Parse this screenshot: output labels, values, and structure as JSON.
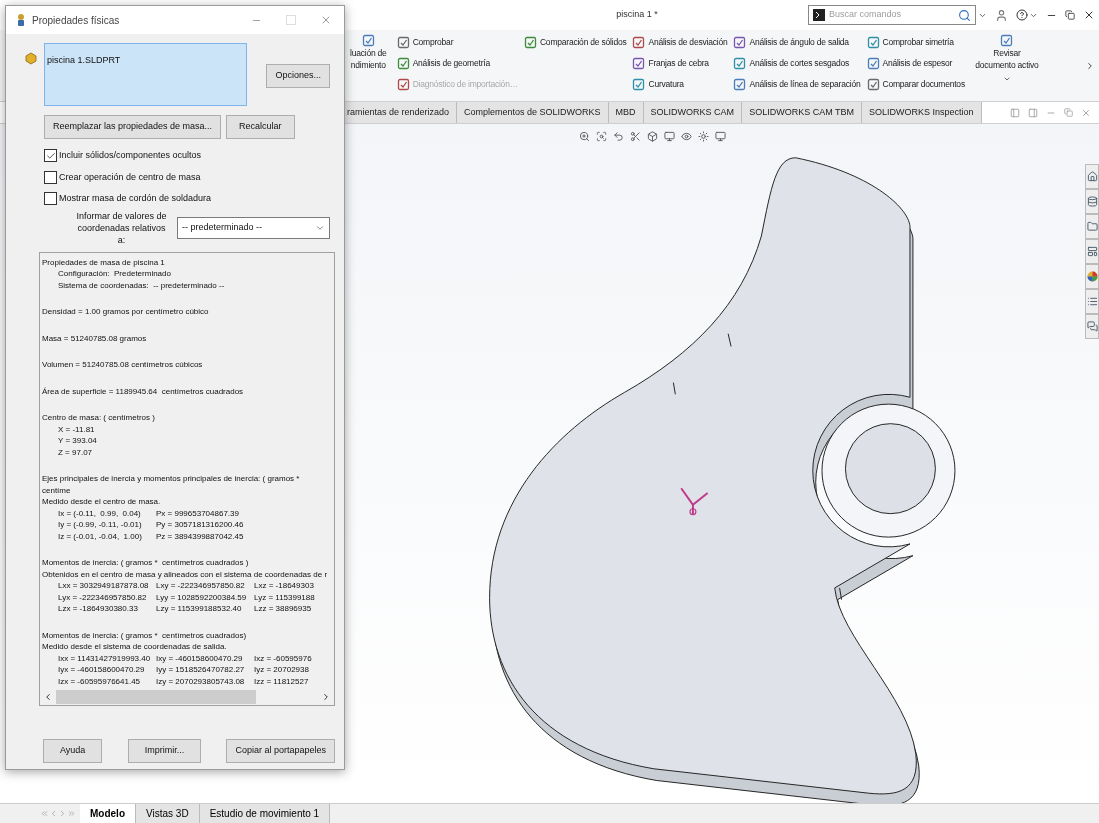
{
  "app": {
    "title": "piscina 1 *",
    "search": {
      "placeholder": "Buscar comandos"
    }
  },
  "ribbon": {
    "groups": [
      {
        "kind": "large",
        "lines": [
          "luación de",
          "ndimiento"
        ]
      },
      {
        "kind": "list",
        "items": [
          {
            "label": "Comprobar",
            "disabled": false
          },
          {
            "label": "Análisis de geometría",
            "disabled": false
          },
          {
            "label": "Diagnóstico de importación…",
            "disabled": true
          }
        ]
      },
      {
        "kind": "list",
        "items": [
          {
            "label": "Comparación de sólidos",
            "disabled": false
          }
        ]
      },
      {
        "kind": "list",
        "items": [
          {
            "label": "Análisis de desviación",
            "disabled": false
          },
          {
            "label": "Franjas de cebra",
            "disabled": false
          },
          {
            "label": "Curvatura",
            "disabled": false
          }
        ]
      },
      {
        "kind": "list",
        "items": [
          {
            "label": "Análisis de ángulo de salida",
            "disabled": false
          },
          {
            "label": "Análisis de cortes sesgados",
            "disabled": false
          },
          {
            "label": "Análisis de línea de separación",
            "disabled": false
          }
        ]
      },
      {
        "kind": "list",
        "items": [
          {
            "label": "Comprobar simetría",
            "disabled": false
          },
          {
            "label": "Análisis de espesor",
            "disabled": false
          },
          {
            "label": "Comparar documentos",
            "disabled": false
          }
        ]
      },
      {
        "kind": "large",
        "lines": [
          "Revisar documento activo"
        ]
      }
    ]
  },
  "command_tabs": [
    {
      "label": "ramientas de renderizado",
      "selected": false
    },
    {
      "label": "Complementos de SOLIDWORKS",
      "selected": false
    },
    {
      "label": "MBD",
      "selected": false
    },
    {
      "label": "SOLIDWORKS CAM",
      "selected": false
    },
    {
      "label": "SOLIDWORKS CAM TBM",
      "selected": false
    },
    {
      "label": "SOLIDWORKS Inspection",
      "selected": false
    }
  ],
  "bottom_tabs": [
    {
      "label": "Modelo",
      "selected": true
    },
    {
      "label": "Vistas 3D",
      "selected": false
    },
    {
      "label": "Estudio de movimiento 1",
      "selected": false
    }
  ],
  "dialog": {
    "title": "Propiedades físicas",
    "list_item": "piscina 1.SLDPRT",
    "options_button": "Opciones...",
    "replace_button": "Reemplazar las propiedades de masa...",
    "recalc_button": "Recalcular",
    "checkboxes": [
      {
        "label": "Incluir sólidos/componentes ocultos",
        "checked": true
      },
      {
        "label": "Crear operación de centro de masa",
        "checked": false
      },
      {
        "label": "Mostrar masa de cordón de soldadura",
        "checked": false
      }
    ],
    "coord_label": "Informar de valores de coordenadas relativos a:",
    "coord_select": "-- predeterminado --",
    "results": [
      {
        "text": "Propiedades de masa de piscina 1",
        "children": [
          {
            "text": "Configuración:  Predeterminado"
          },
          {
            "text": "Sistema de coordenadas:  -- predeterminado --"
          }
        ]
      },
      {
        "text": "Densidad = 1.00 gramos por centímetro cúbico"
      },
      {
        "text": "Masa = 51240785.08 gramos"
      },
      {
        "text": "Volumen = 51240785.08 centímetros cúbicos"
      },
      {
        "text": "Área de superficie = 1189945.64  centímetros cuadrados"
      },
      {
        "text": "Centro de masa: ( centímetros )",
        "children": [
          {
            "text": "X = -11.81"
          },
          {
            "text": "Y = 393.04"
          },
          {
            "text": "Z = 97.07"
          }
        ]
      },
      {
        "text": "Ejes principales de inercia y momentos principales de inercia: ( gramos *  centíme",
        "subtitle": "Medido desde el centro de masa.",
        "children": [
          {
            "cells": [
              "Ix = (-0.11,  0.99,  0.04)",
              "Px = 999653704867.39"
            ]
          },
          {
            "cells": [
              "Iy = (-0.99, -0.11, -0.01)",
              "Py = 3057181316200.46"
            ]
          },
          {
            "cells": [
              "Iz = (-0.01, -0.04,  1.00)",
              "Pz = 3894399887042.45"
            ]
          }
        ]
      },
      {
        "text": "Momentos de inercia: ( gramos *  centímetros cuadrados )",
        "subtitle": "Obtenidos en el centro de masa y alineados con el sistema de coordenadas de r",
        "children": [
          {
            "cells": [
              "Lxx = 3032949187878.08",
              "Lxy = -222346957850.82",
              "Lxz = -18649303"
            ]
          },
          {
            "cells": [
              "Lyx = -222346957850.82",
              "Lyy = 1028592200384.59",
              "Lyz = 115399188"
            ]
          },
          {
            "cells": [
              "Lzx = -1864930380.33",
              "Lzy = 115399188532.40",
              "Lzz = 38896935"
            ]
          }
        ]
      },
      {
        "text": "Momentos de inercia: ( gramos *  centímetros cuadrados)",
        "subtitle": "Medido desde el sistema de coordenadas de salida.",
        "children": [
          {
            "cells": [
              "Ixx = 11431427919993.40",
              "Ixy = -460158600470.29",
              "Ixz = -60595976"
            ]
          },
          {
            "cells": [
              "Iyx = -460158600470.29",
              "Iyy = 1518526470782.27",
              "Iyz = 20702938"
            ]
          },
          {
            "cells": [
              "Izx = -60595976641.45",
              "Izy = 2070293805743.08",
              "Izz = 11812527"
            ]
          }
        ]
      }
    ],
    "footer_buttons": [
      "Ayuda",
      "Imprimir...",
      "Copiar al portapapeles"
    ]
  }
}
